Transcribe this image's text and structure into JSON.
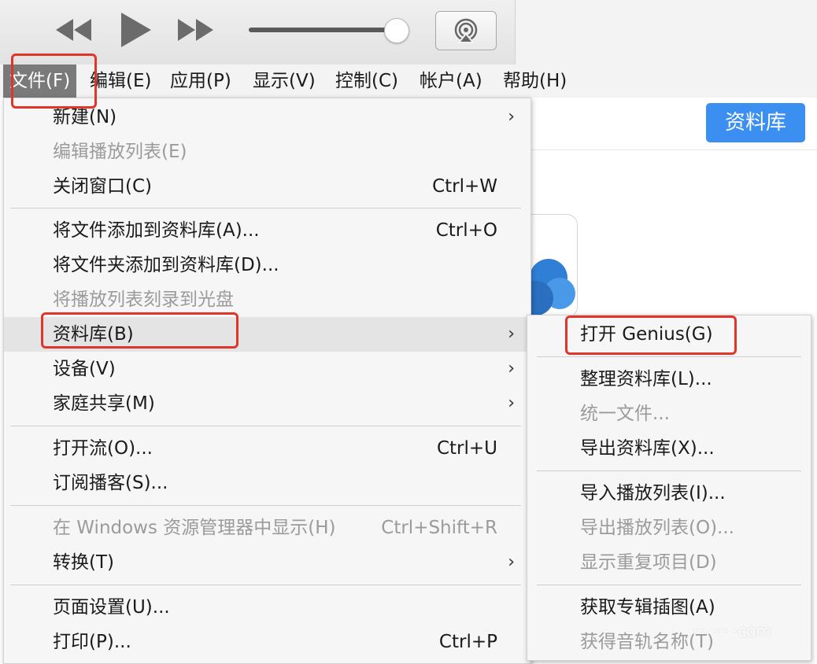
{
  "menubar": {
    "items": [
      {
        "label": "文件(F)"
      },
      {
        "label": "编辑(E)"
      },
      {
        "label": "应用(P)"
      },
      {
        "label": "显示(V)"
      },
      {
        "label": "控制(C)"
      },
      {
        "label": "帐户(A)"
      },
      {
        "label": "帮助(H)"
      }
    ]
  },
  "header": {
    "library_button": "资料库"
  },
  "file_menu": {
    "items": [
      {
        "label": "新建(N)",
        "submenu": true
      },
      {
        "label": "编辑播放列表(E)",
        "disabled": true
      },
      {
        "label": "关闭窗口(C)",
        "shortcut": "Ctrl+W"
      },
      {
        "label": "将文件添加到资料库(A)...",
        "shortcut": "Ctrl+O"
      },
      {
        "label": "将文件夹添加到资料库(D)..."
      },
      {
        "label": "将播放列表刻录到光盘",
        "disabled": true
      },
      {
        "label": "资料库(B)",
        "submenu": true,
        "highlighted": true
      },
      {
        "label": "设备(V)",
        "submenu": true
      },
      {
        "label": "家庭共享(M)",
        "submenu": true
      },
      {
        "label": "打开流(O)...",
        "shortcut": "Ctrl+U"
      },
      {
        "label": "订阅播客(S)..."
      },
      {
        "label": "在 Windows 资源管理器中显示(H)",
        "shortcut": "Ctrl+Shift+R",
        "disabled": true
      },
      {
        "label": "转换(T)",
        "submenu": true
      },
      {
        "label": "页面设置(U)..."
      },
      {
        "label": "打印(P)...",
        "shortcut": "Ctrl+P"
      }
    ]
  },
  "library_submenu": {
    "items": [
      {
        "label": "打开 Genius(G)"
      },
      {
        "label": "整理资料库(L)..."
      },
      {
        "label": "统一文件...",
        "disabled": true
      },
      {
        "label": "导出资料库(X)..."
      },
      {
        "label": "导入播放列表(I)..."
      },
      {
        "label": "导出播放列表(O)...",
        "disabled": true
      },
      {
        "label": "显示重复项目(D)",
        "disabled": true
      },
      {
        "label": "获取专辑插图(A)"
      },
      {
        "label": "获得音轨名称(T)",
        "disabled": true
      }
    ]
  },
  "watermark": "··· ··· ·com",
  "icons": {
    "rewind": "rewind-icon",
    "play": "play-icon",
    "fast_forward": "fast-forward-icon",
    "airplay": "airplay-icon",
    "submenu_arrow": "chevron-right-icon"
  },
  "colors": {
    "accent": "#3b8ff0",
    "highlight_box": "#e0352b",
    "menu_bg": "#f6f6f6",
    "disabled_text": "#9b9b9b"
  }
}
